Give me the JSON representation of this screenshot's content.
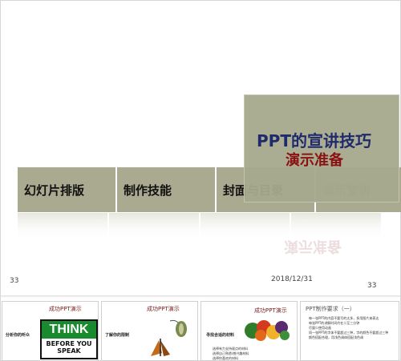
{
  "main_slide": {
    "tabs": [
      "幻灯片排版",
      "制作技能",
      "封面与目录",
      "演示宣讲"
    ],
    "title_line1": "PPT的宣讲技巧",
    "title_line2": "演示准备",
    "page_left": "33",
    "date": "2018/12/31",
    "page_right": "33"
  },
  "thumbnails": [
    {
      "title": "成功PPT演示",
      "label": "分析你的听众",
      "think_top": "THINK",
      "think_bottom": "BEFORE YOU SPEAK"
    },
    {
      "title": "成功PPT演示",
      "label": "了解你的限制"
    },
    {
      "title": "成功PPT演示",
      "label": "寻找合适的材料",
      "bullets": [
        "选择有力支持观点的材料",
        "选择自己熟悉/感兴趣材料",
        "选择你喜欢的材料"
      ]
    },
    {
      "title": "PPT制作要求（一）",
      "bullets": [
        "每一张PPT的内容不要写的太多，多用图片来表达",
        "每张PPT的讲解时间约在二至三分钟",
        "尽量少使用动画",
        "同一张PPT的字体不要超过三种，字的颜色不要超过三种",
        "颜色搭配合理，用浅色调体搭配浅色调"
      ]
    }
  ],
  "colors": {
    "tab_bg": "#a9aa8f",
    "title_blue": "#1f2a6b",
    "title_red": "#8a1111"
  }
}
